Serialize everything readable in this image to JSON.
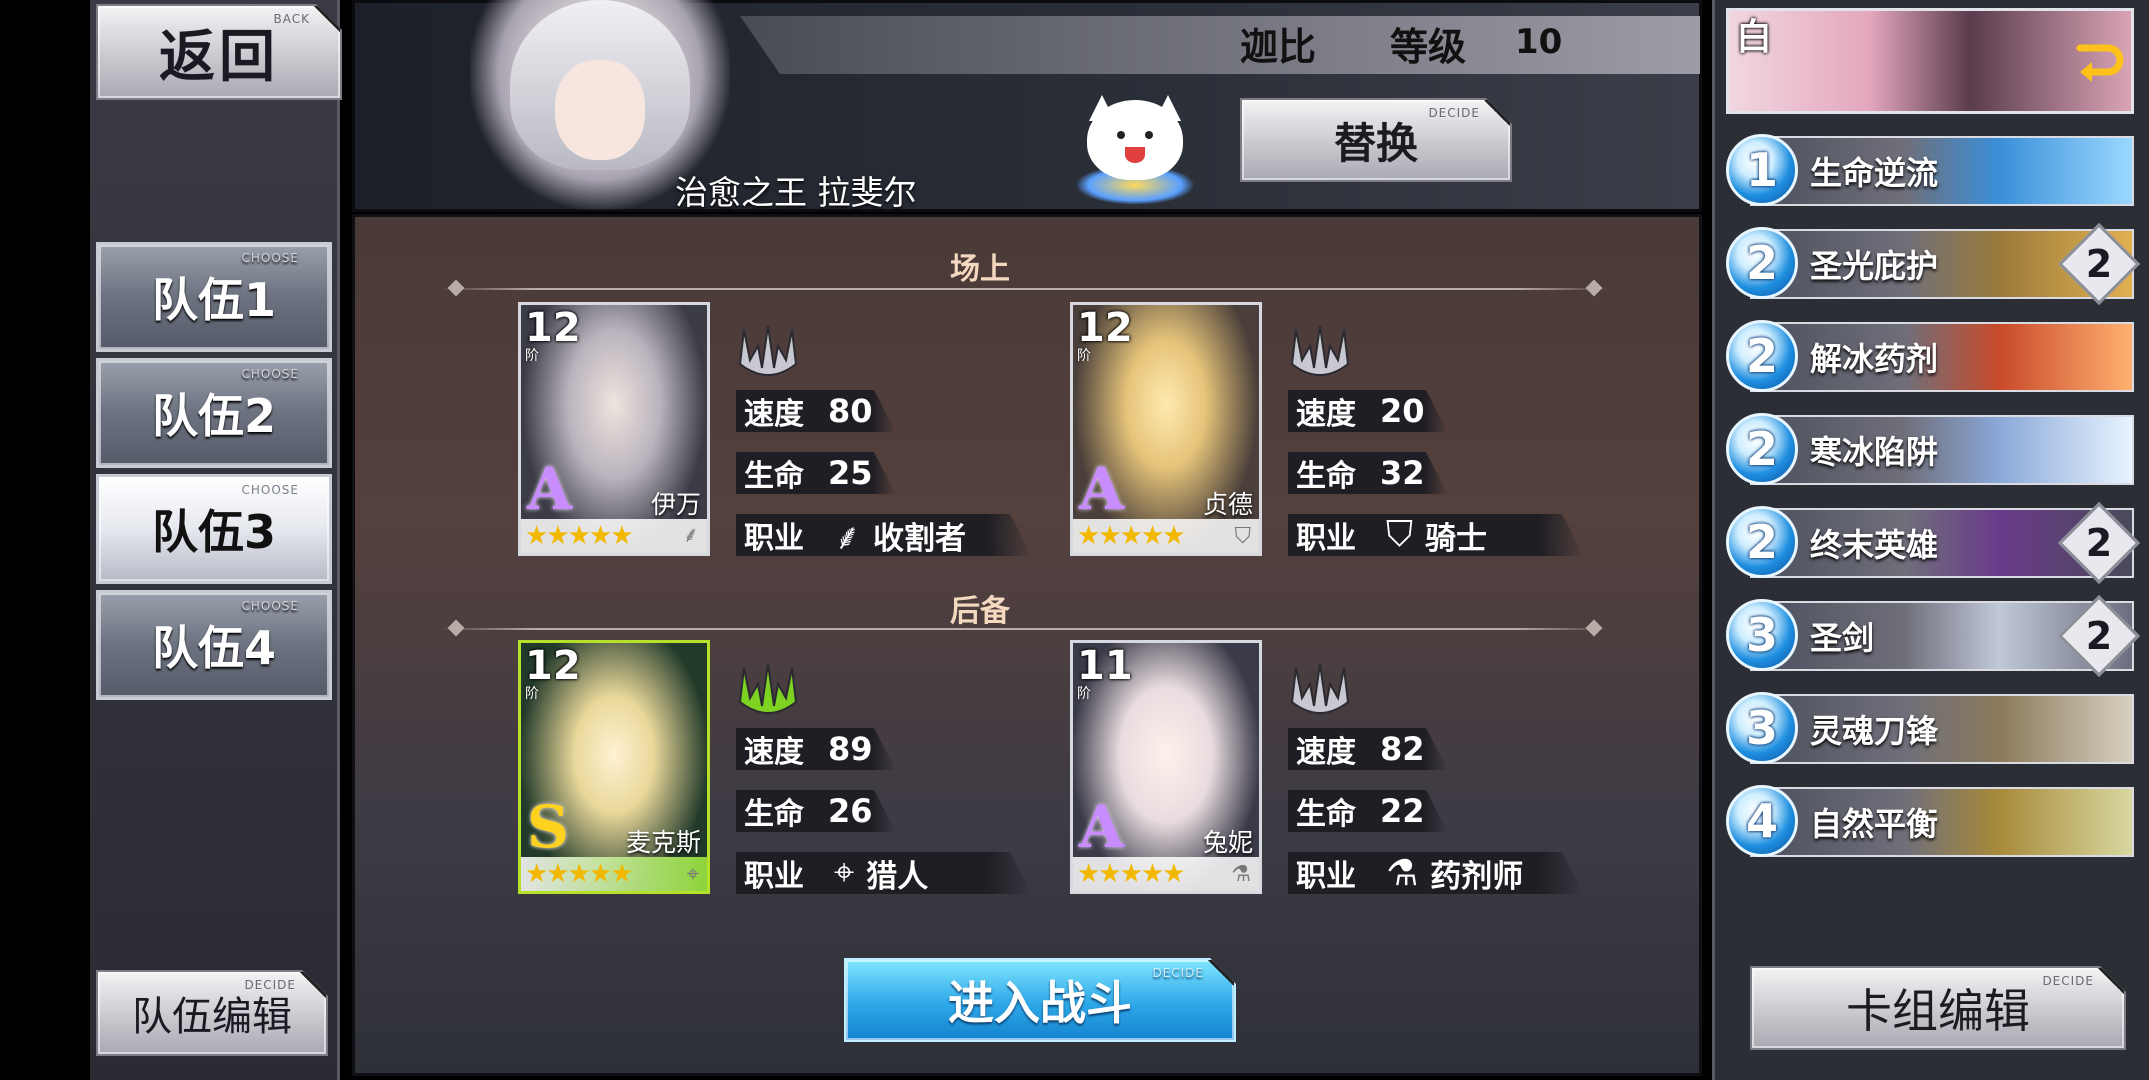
{
  "left_panel": {
    "back": {
      "label": "返回",
      "sub": "BACK"
    },
    "teams": [
      {
        "label": "队伍1",
        "sub": "CHOOSE",
        "active": false
      },
      {
        "label": "队伍2",
        "sub": "CHOOSE",
        "active": false
      },
      {
        "label": "队伍3",
        "sub": "CHOOSE",
        "active": true
      },
      {
        "label": "队伍4",
        "sub": "CHOOSE",
        "active": false
      }
    ],
    "team_edit": {
      "label": "队伍编辑",
      "sub": "DECIDE"
    }
  },
  "header": {
    "player_name": "迦比",
    "level_label": "等级",
    "level": "10",
    "leader_title": "治愈之王 拉斐尔",
    "replace_button": {
      "label": "替换",
      "sub": "DECIDE"
    }
  },
  "main": {
    "onfield_title": "场上",
    "reserve_title": "后备",
    "stat_labels": {
      "speed": "速度",
      "hp": "生命",
      "class": "职业"
    },
    "onfield": [
      {
        "tier": "12",
        "tier_sub": "阶",
        "rank": "A",
        "name": "伊万",
        "stars": "★★★★★",
        "speed": "80",
        "hp": "25",
        "class": "收割者",
        "class_icon": "scythe-icon",
        "tri_color": "#c8c8d0"
      },
      {
        "tier": "12",
        "tier_sub": "阶",
        "rank": "A",
        "name": "贞德",
        "stars": "★★★★★",
        "speed": "20",
        "hp": "32",
        "class": "骑士",
        "class_icon": "shield-sword-icon",
        "tri_color": "#c8c8d0"
      }
    ],
    "reserve": [
      {
        "tier": "12",
        "tier_sub": "阶",
        "rank": "S",
        "name": "麦克斯",
        "stars": "★★★★★",
        "speed": "89",
        "hp": "26",
        "class": "猎人",
        "class_icon": "bow-icon",
        "tri_color": "#7ed321"
      },
      {
        "tier": "11",
        "tier_sub": "阶",
        "rank": "A",
        "name": "兔妮",
        "stars": "★★★★★",
        "speed": "82",
        "hp": "22",
        "class": "药剂师",
        "class_icon": "flask-icon",
        "tri_color": "#c8c8d0"
      }
    ],
    "enter_battle": {
      "label": "进入战斗",
      "sub": "DECIDE"
    }
  },
  "deck": {
    "tag": "白",
    "cards": [
      {
        "cost": "1",
        "name": "生命逆流",
        "count": "",
        "c1": "#3a8fd8",
        "c2": "#9ad8ff"
      },
      {
        "cost": "2",
        "name": "圣光庇护",
        "count": "2",
        "c1": "#9a7a3a",
        "c2": "#e0b050"
      },
      {
        "cost": "2",
        "name": "解冰药剂",
        "count": "",
        "c1": "#c84a2a",
        "c2": "#ffb070"
      },
      {
        "cost": "2",
        "name": "寒冰陷阱",
        "count": "",
        "c1": "#8aa8d8",
        "c2": "#e8f4ff"
      },
      {
        "cost": "2",
        "name": "终末英雄",
        "count": "2",
        "c1": "#6a3a8a",
        "c2": "#4a4a5a"
      },
      {
        "cost": "3",
        "name": "圣剑",
        "count": "2",
        "c1": "#c0c8d8",
        "c2": "#6a6e7e"
      },
      {
        "cost": "3",
        "name": "灵魂刀锋",
        "count": "",
        "c1": "#8a7a5a",
        "c2": "#d8d0c0"
      },
      {
        "cost": "4",
        "name": "自然平衡",
        "count": "",
        "c1": "#a88a3a",
        "c2": "#d8d8a0"
      }
    ],
    "deck_edit": {
      "label": "卡组编辑",
      "sub": "DECIDE"
    }
  },
  "colors": {
    "accent_blue": "#2ea8e8",
    "star_gold": "#f2b800",
    "rank_a": "#c98cff",
    "rank_s": "#ffd21f"
  }
}
